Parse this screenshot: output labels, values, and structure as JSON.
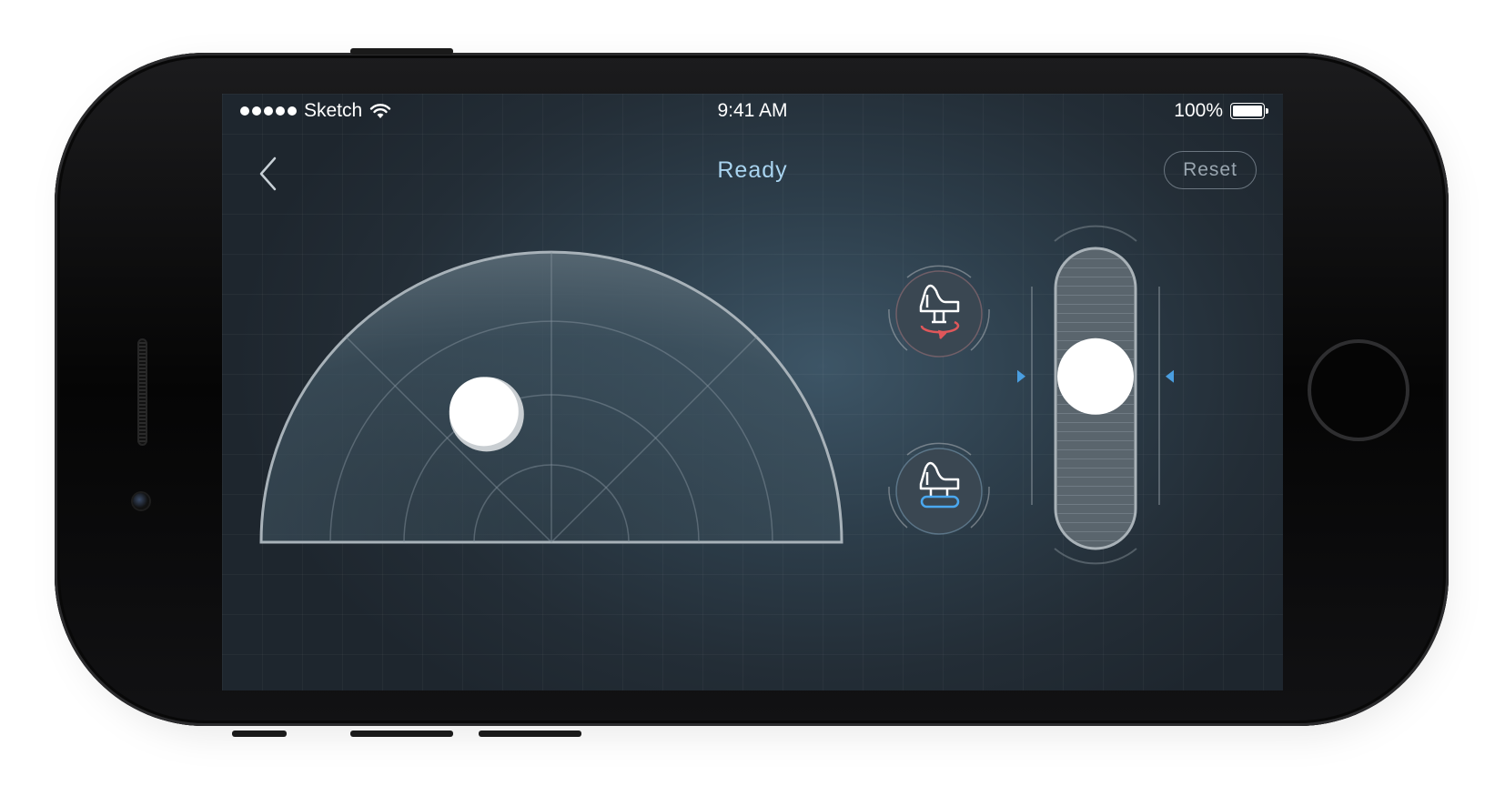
{
  "status_bar": {
    "carrier": "Sketch",
    "time": "9:41 AM",
    "battery_percent": "100%",
    "signal_bars": 5,
    "battery_level": 1.0
  },
  "nav": {
    "title": "Ready",
    "reset_label": "Reset",
    "back_icon": "chevron-left-icon"
  },
  "colors": {
    "title": "#a9d4f0",
    "rotate_accent": "#e0575a",
    "lift_accent": "#4aa8f0",
    "slider_marker": "#4a9ee0"
  },
  "controls": {
    "joystick": {
      "type": "semicircle-pad",
      "knob_angle_deg": 117,
      "knob_radius_fraction": 0.5
    },
    "rotate_button": {
      "icon": "piano-rotate-icon"
    },
    "lift_button": {
      "icon": "piano-lift-icon"
    },
    "vertical_slider": {
      "value": 0.6
    }
  }
}
